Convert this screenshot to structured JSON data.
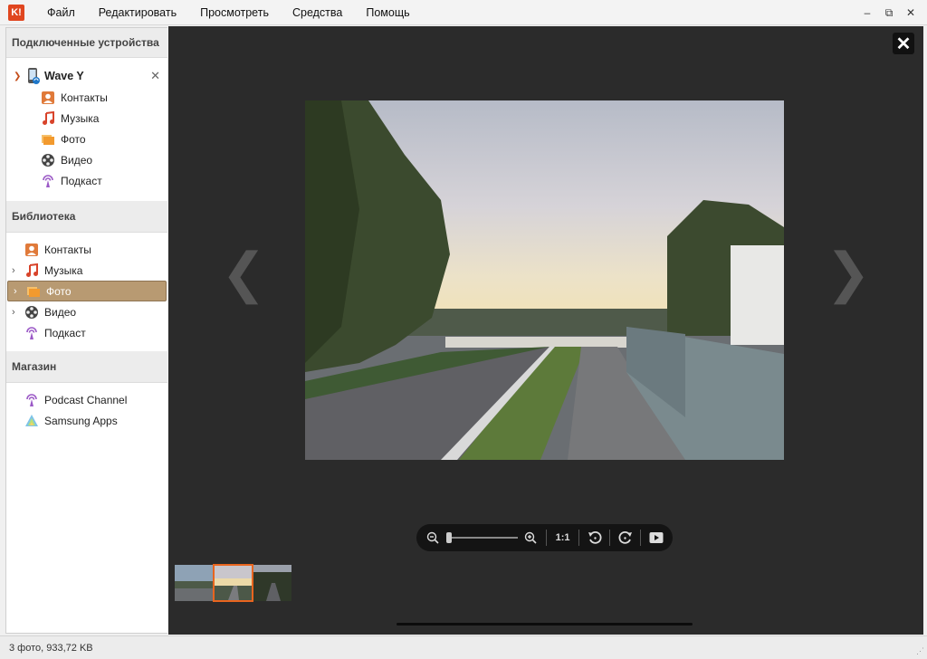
{
  "app": {
    "logo_text": "K!"
  },
  "menu": {
    "file": "Файл",
    "edit": "Редактировать",
    "view": "Просмотреть",
    "tools": "Средства",
    "help": "Помощь"
  },
  "window_controls": {
    "minimize": "–",
    "restore": "⧉",
    "close": "✕"
  },
  "sidebar": {
    "connected_header": "Подключенные устройства",
    "device": {
      "name": "Wave Y",
      "close": "✕",
      "items": [
        {
          "label": "Контакты",
          "icon": "contacts-icon"
        },
        {
          "label": "Музыка",
          "icon": "music-icon"
        },
        {
          "label": "Фото",
          "icon": "photo-icon"
        },
        {
          "label": "Видео",
          "icon": "video-icon"
        },
        {
          "label": "Подкаст",
          "icon": "podcast-icon"
        }
      ]
    },
    "library_header": "Библиотека",
    "library": [
      {
        "label": "Контакты",
        "icon": "contacts-icon",
        "expandable": false
      },
      {
        "label": "Музыка",
        "icon": "music-icon",
        "expandable": true
      },
      {
        "label": "Фото",
        "icon": "photo-icon",
        "expandable": true,
        "selected": true
      },
      {
        "label": "Видео",
        "icon": "video-icon",
        "expandable": true
      },
      {
        "label": "Подкаст",
        "icon": "podcast-icon",
        "expandable": false
      }
    ],
    "store_header": "Магазин",
    "store": [
      {
        "label": "Podcast Channel",
        "icon": "podcast-icon"
      },
      {
        "label": "Samsung Apps",
        "icon": "samsung-apps-icon"
      }
    ]
  },
  "viewer": {
    "close": "✕",
    "prev_arrow": "❮",
    "next_arrow": "❯",
    "zoom_ratio_label": "1:1",
    "zoom_level": 0.0,
    "thumbnails_count": 3,
    "selected_thumbnail": 2
  },
  "status": {
    "text": "3 фото, 933,72 KB"
  },
  "colors": {
    "accent": "#e8651f",
    "selection": "#b89a72",
    "viewer_bg": "#2b2b2b"
  }
}
